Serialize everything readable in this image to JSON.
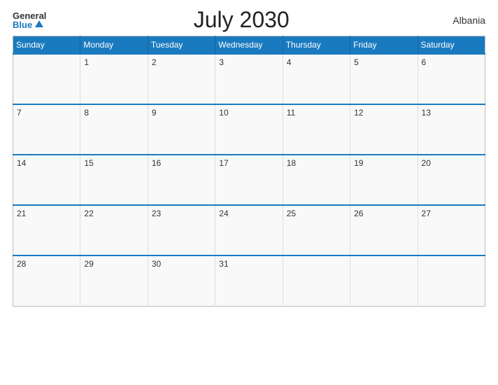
{
  "header": {
    "logo_general": "General",
    "logo_blue": "Blue",
    "title": "July 2030",
    "country": "Albania"
  },
  "days_of_week": [
    "Sunday",
    "Monday",
    "Tuesday",
    "Wednesday",
    "Thursday",
    "Friday",
    "Saturday"
  ],
  "weeks": [
    [
      "",
      "1",
      "2",
      "3",
      "4",
      "5",
      "6"
    ],
    [
      "7",
      "8",
      "9",
      "10",
      "11",
      "12",
      "13"
    ],
    [
      "14",
      "15",
      "16",
      "17",
      "18",
      "19",
      "20"
    ],
    [
      "21",
      "22",
      "23",
      "24",
      "25",
      "26",
      "27"
    ],
    [
      "28",
      "29",
      "30",
      "31",
      "",
      "",
      ""
    ]
  ]
}
